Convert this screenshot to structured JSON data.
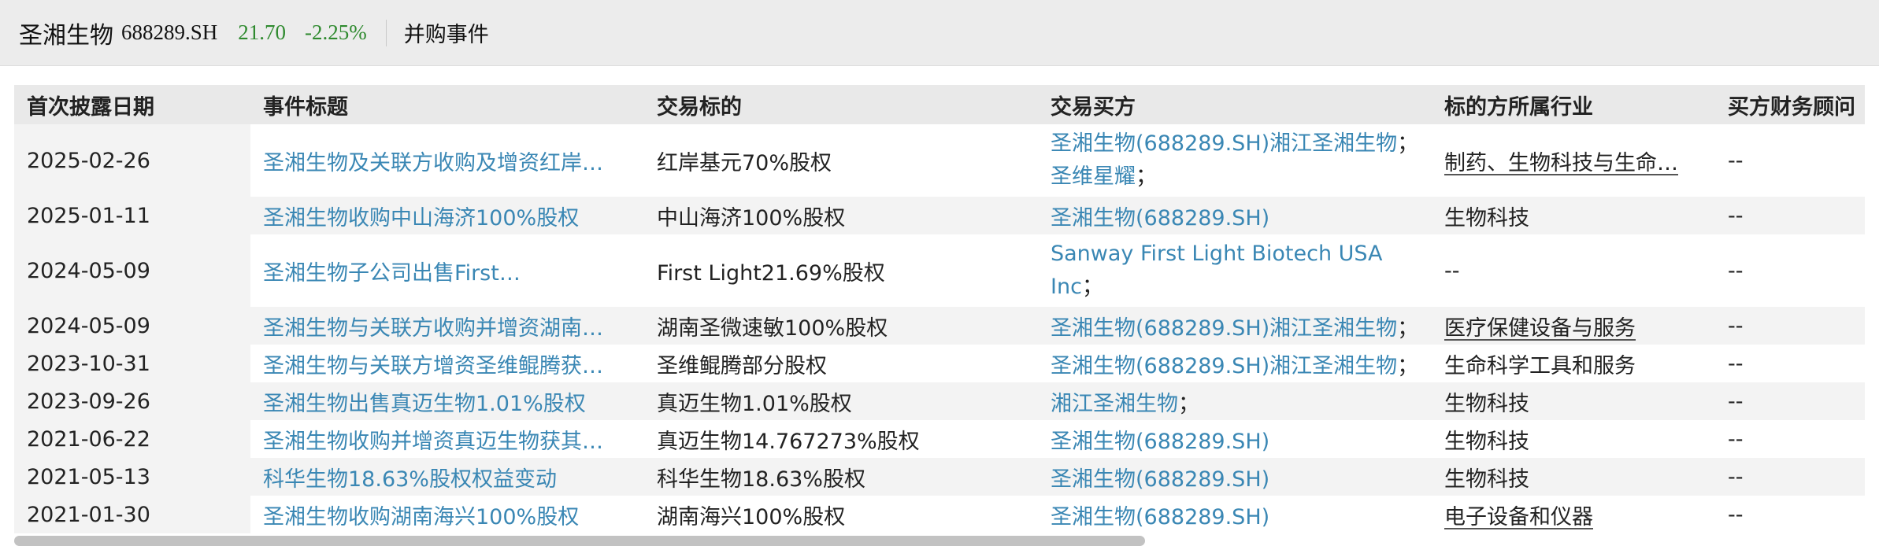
{
  "header": {
    "stock_name": "圣湘生物",
    "stock_code": "688289.SH",
    "price": "21.70",
    "change_pct": "-2.25%",
    "section": "并购事件"
  },
  "colors": {
    "link": "#3a87b4",
    "positive_green": "#2f8a2f"
  },
  "table": {
    "columns": [
      "首次披露日期",
      "事件标题",
      "交易标的",
      "交易买方",
      "标的方所属行业",
      "买方财务顾问"
    ],
    "rows": [
      {
        "date": "2025-02-26",
        "title": "圣湘生物及关联方收购及增资红岸…",
        "target": "红岸基元70%股权",
        "buyer": [
          "圣湘生物(688289.SH)",
          "湘江圣湘生物",
          "圣维星耀"
        ],
        "industry": "制药、生物科技与生命…",
        "advisor": "--"
      },
      {
        "date": "2025-01-11",
        "title": "圣湘生物收购中山海济100%股权",
        "target": "中山海济100%股权",
        "buyer": [
          "圣湘生物(688289.SH)"
        ],
        "industry": "生物科技",
        "advisor": "--"
      },
      {
        "date": "2024-05-09",
        "title": "圣湘生物子公司出售First…",
        "target": "First Light21.69%股权",
        "buyer": [
          "Sanway First Light Biotech USA Inc"
        ],
        "industry": "--",
        "advisor": "--"
      },
      {
        "date": "2024-05-09",
        "title": "圣湘生物与关联方收购并增资湖南…",
        "target": "湖南圣微速敏100%股权",
        "buyer": [
          "圣湘生物(688289.SH)",
          "湘江圣湘生物"
        ],
        "industry": "医疗保健设备与服务",
        "advisor": "--"
      },
      {
        "date": "2023-10-31",
        "title": "圣湘生物与关联方增资圣维鲲腾获…",
        "target": "圣维鲲腾部分股权",
        "buyer": [
          "圣湘生物(688289.SH)",
          "湘江圣湘生物"
        ],
        "industry": "生命科学工具和服务",
        "advisor": "--"
      },
      {
        "date": "2023-09-26",
        "title": "圣湘生物出售真迈生物1.01%股权",
        "target": "真迈生物1.01%股权",
        "buyer": [
          "湘江圣湘生物"
        ],
        "industry": "生物科技",
        "advisor": "--"
      },
      {
        "date": "2021-06-22",
        "title": "圣湘生物收购并增资真迈生物获其…",
        "target": "真迈生物14.767273%股权",
        "buyer": [
          "圣湘生物(688289.SH)"
        ],
        "industry": "生物科技",
        "advisor": "--"
      },
      {
        "date": "2021-05-13",
        "title": "科华生物18.63%股权权益变动",
        "target": "科华生物18.63%股权",
        "buyer": [
          "圣湘生物(688289.SH)"
        ],
        "industry": "生物科技",
        "advisor": "--"
      },
      {
        "date": "2021-01-30",
        "title": "圣湘生物收购湖南海兴100%股权",
        "target": "湖南海兴100%股权",
        "buyer": [
          "圣湘生物(688289.SH)"
        ],
        "industry": "电子设备和仪器",
        "advisor": "--"
      }
    ]
  },
  "scroll": {
    "horizontal_position": 0.0,
    "horizontal_visible_fraction": 0.61
  }
}
